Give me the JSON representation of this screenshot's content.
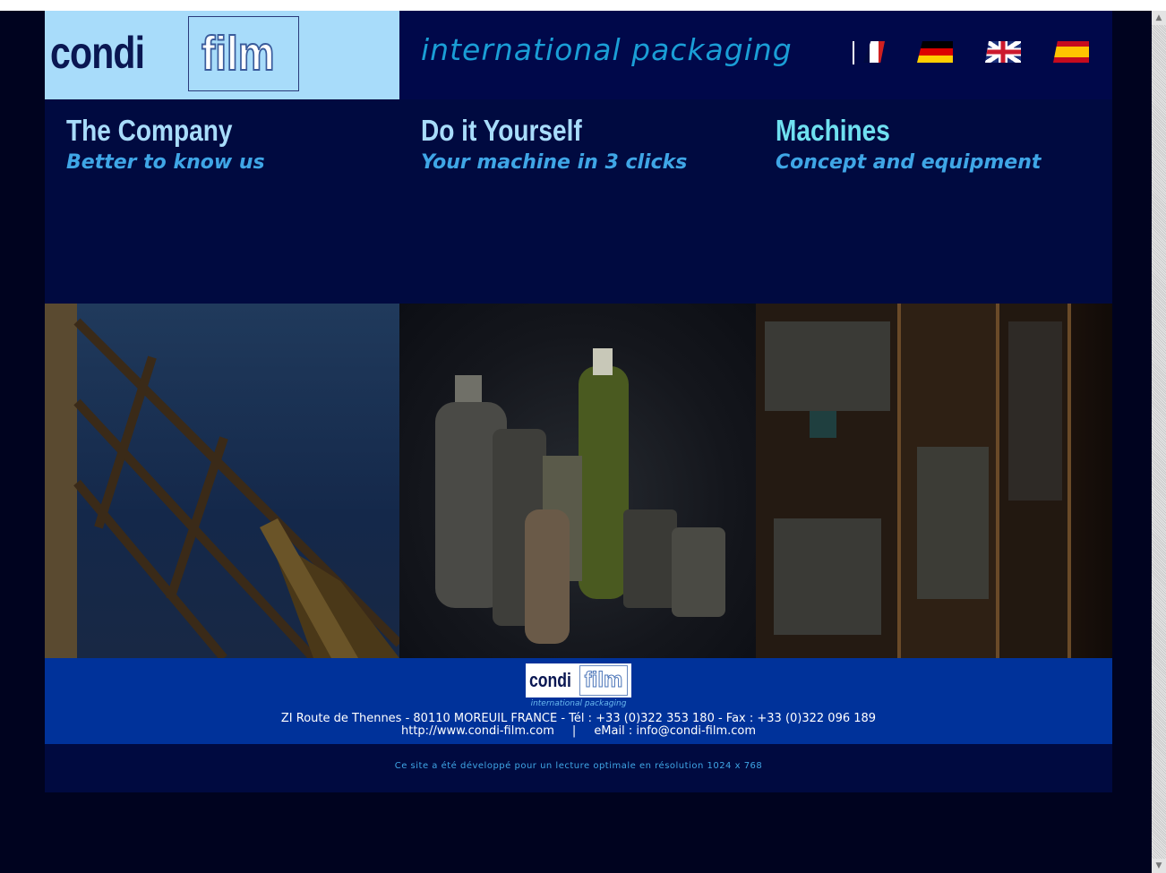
{
  "header": {
    "logo_condi": "condi",
    "logo_film": "film",
    "tagline": "international packaging",
    "languages": [
      {
        "code": "fr",
        "icon": "flag-france-icon"
      },
      {
        "code": "de",
        "icon": "flag-germany-icon"
      },
      {
        "code": "en",
        "icon": "flag-uk-icon"
      },
      {
        "code": "es",
        "icon": "flag-spain-icon"
      }
    ]
  },
  "nav": {
    "columns": [
      {
        "title": "The Company",
        "subtitle": "Better to know us",
        "title_color": "#a8dcfa"
      },
      {
        "title": "Do it Yourself",
        "subtitle": "Your machine in 3 clicks",
        "title_color": "#a8dcfa"
      },
      {
        "title": "Machines",
        "subtitle": "Concept and equipment",
        "title_color": "#6fe0f0"
      }
    ]
  },
  "gallery": {
    "images": [
      "building-photo",
      "containers-photo",
      "machine-photo"
    ]
  },
  "footer": {
    "logo_condi": "condi",
    "logo_film": "film",
    "logo_tag": "international packaging",
    "address": "ZI Route de Thennes - 80110 MOREUIL FRANCE - Tél : +33 (0)322 353 180 - Fax : +33 (0)322 096 189",
    "website": "http://www.condi-film.com",
    "separator": "|",
    "email": "eMail : info@condi-film.com"
  },
  "notice": "Ce site a été développé pour un lecture optimale en résolution 1024 x 768",
  "colors": {
    "background": "#00031f",
    "header_blue": "#00084a",
    "logo_bg": "#a8dcfa",
    "accent": "#1a9ed6",
    "footer_blue": "#00329a"
  }
}
